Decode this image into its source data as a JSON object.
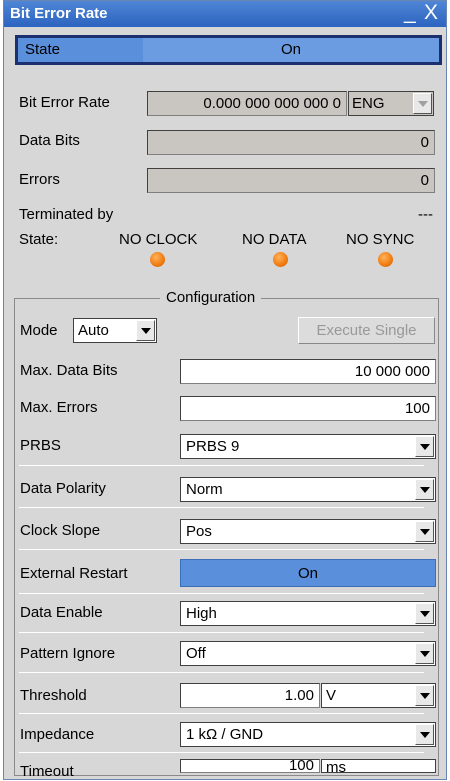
{
  "window": {
    "title": "Bit Error Rate",
    "min_label": "_",
    "close_label": "X"
  },
  "state": {
    "label": "State",
    "value": "On"
  },
  "ber": {
    "label": "Bit Error Rate",
    "value": "0.000 000 000 000 0",
    "unit": "ENG"
  },
  "data_bits": {
    "label": "Data Bits",
    "value": "0"
  },
  "errors": {
    "label": "Errors",
    "value": "0"
  },
  "terminated": {
    "label": "Terminated by",
    "value": "---"
  },
  "status": {
    "label": "State:",
    "items": [
      {
        "label": "NO CLOCK"
      },
      {
        "label": "NO DATA"
      },
      {
        "label": "NO SYNC"
      }
    ],
    "led_color": "#f07a10"
  },
  "config": {
    "title": "Configuration",
    "mode": {
      "label": "Mode",
      "value": "Auto"
    },
    "execute_single": "Execute Single",
    "max_data_bits": {
      "label": "Max. Data Bits",
      "value": "10 000 000"
    },
    "max_errors": {
      "label": "Max. Errors",
      "value": "100"
    },
    "prbs": {
      "label": "PRBS",
      "value": "PRBS 9"
    },
    "data_polarity": {
      "label": "Data Polarity",
      "value": "Norm"
    },
    "clock_slope": {
      "label": "Clock Slope",
      "value": "Pos"
    },
    "external_restart": {
      "label": "External Restart",
      "value": "On"
    },
    "data_enable": {
      "label": "Data Enable",
      "value": "High"
    },
    "pattern_ignore": {
      "label": "Pattern Ignore",
      "value": "Off"
    },
    "threshold": {
      "label": "Threshold",
      "value": "1.00",
      "unit": "V"
    },
    "impedance": {
      "label": "Impedance",
      "value": "1 kΩ / GND"
    },
    "timeout": {
      "label": "Timeout",
      "value": "100",
      "unit": "ms"
    }
  },
  "colors": {
    "title_bar": "#2c63bf",
    "toggle_on": "#5a8fdc",
    "panel": "#d7d7d7",
    "readonly": "#c9c5c0"
  }
}
